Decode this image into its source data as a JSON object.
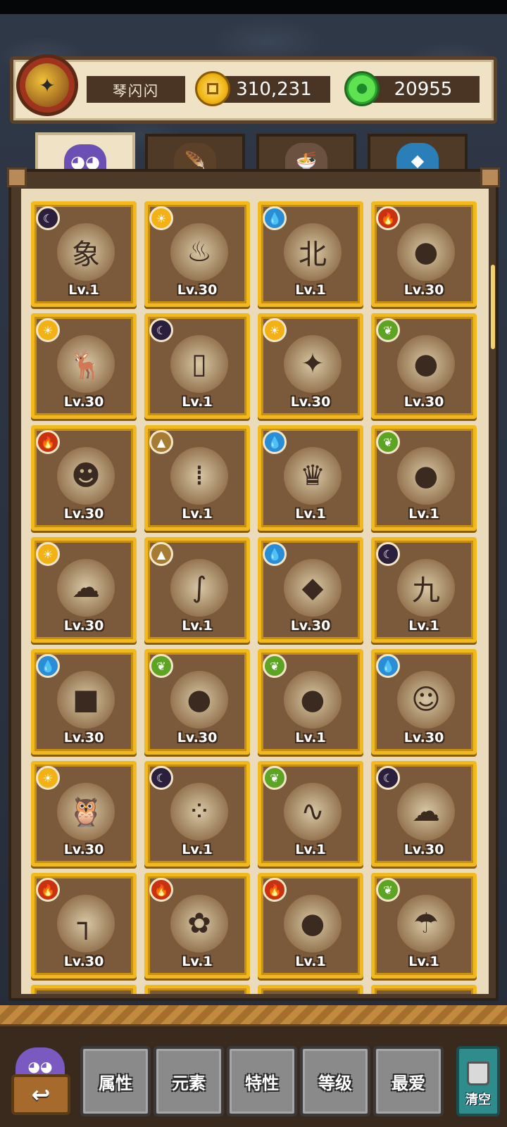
{
  "header": {
    "player_name": "琴闪闪",
    "coins": "310,231",
    "jade": "20955"
  },
  "tabs": [
    {
      "name": "tab-monsters",
      "icon": "monster-icon",
      "active": true
    },
    {
      "name": "tab-items",
      "icon": "feather-hat-icon",
      "active": false
    },
    {
      "name": "tab-food",
      "icon": "noodle-bowl-icon",
      "active": false
    },
    {
      "name": "tab-crystals",
      "icon": "crystal-icon",
      "active": false
    }
  ],
  "cards": [
    {
      "element": "moon",
      "art": "象",
      "level": "Lv.1"
    },
    {
      "element": "sun",
      "art": "♨",
      "level": "Lv.30"
    },
    {
      "element": "water",
      "art": "北",
      "level": "Lv.1"
    },
    {
      "element": "fire",
      "art": "●",
      "level": "Lv.30"
    },
    {
      "element": "sun",
      "art": "🦌",
      "level": "Lv.30"
    },
    {
      "element": "moon",
      "art": "▯",
      "level": "Lv.1"
    },
    {
      "element": "sun",
      "art": "✦",
      "level": "Lv.30"
    },
    {
      "element": "leaf",
      "art": "●",
      "level": "Lv.30"
    },
    {
      "element": "fire",
      "art": "☻",
      "level": "Lv.30"
    },
    {
      "element": "mountain",
      "art": "⁞",
      "level": "Lv.1"
    },
    {
      "element": "water",
      "art": "♛",
      "level": "Lv.1"
    },
    {
      "element": "leaf",
      "art": "●",
      "level": "Lv.1"
    },
    {
      "element": "sun",
      "art": "☁",
      "level": "Lv.30"
    },
    {
      "element": "mountain",
      "art": "∫",
      "level": "Lv.1"
    },
    {
      "element": "water",
      "art": "◆",
      "level": "Lv.30"
    },
    {
      "element": "moon",
      "art": "九",
      "level": "Lv.1"
    },
    {
      "element": "water",
      "art": "■",
      "level": "Lv.30"
    },
    {
      "element": "leaf",
      "art": "●",
      "level": "Lv.30"
    },
    {
      "element": "leaf",
      "art": "●",
      "level": "Lv.1"
    },
    {
      "element": "water",
      "art": "☺",
      "level": "Lv.30"
    },
    {
      "element": "sun",
      "art": "🦉",
      "level": "Lv.30"
    },
    {
      "element": "moon",
      "art": "⁘",
      "level": "Lv.1"
    },
    {
      "element": "leaf",
      "art": "∿",
      "level": "Lv.1"
    },
    {
      "element": "moon",
      "art": "☁",
      "level": "Lv.30"
    },
    {
      "element": "fire",
      "art": "┐",
      "level": "Lv.30"
    },
    {
      "element": "fire",
      "art": "✿",
      "level": "Lv.1"
    },
    {
      "element": "fire",
      "art": "●",
      "level": "Lv.1"
    },
    {
      "element": "leaf",
      "art": "☂",
      "level": "Lv.1"
    }
  ],
  "element_icons": {
    "moon": "☾",
    "sun": "☀",
    "water": "💧",
    "fire": "🔥",
    "leaf": "❦",
    "mountain": "▲"
  },
  "element_colors": {
    "moon": "#2b1f3d",
    "sun": "#f2b215",
    "water": "#2a8ed6",
    "fire": "#c9320f",
    "leaf": "#5ea424",
    "mountain": "#a67c34"
  },
  "filters": {
    "attribute": "属性",
    "element": "元素",
    "trait": "特性",
    "level": "等级",
    "favorite": "最爱"
  },
  "clear_label": "清空"
}
